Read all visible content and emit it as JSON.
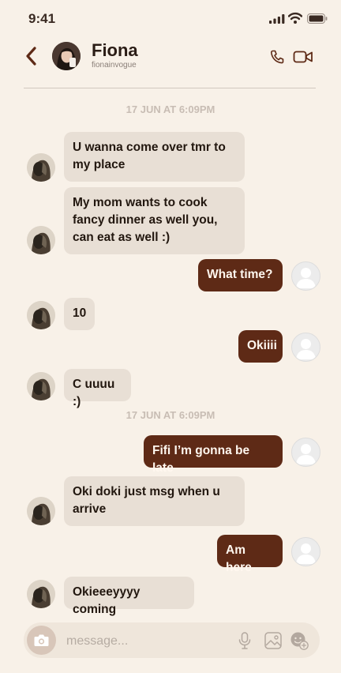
{
  "status_bar": {
    "time": "9:41"
  },
  "header": {
    "name": "Fiona",
    "handle": "fionainvogue"
  },
  "messages": [
    {
      "kind": "timestamp",
      "text": "17 JUN AT 6:09PM"
    },
    {
      "kind": "incoming",
      "text": "U wanna come over tmr to my place"
    },
    {
      "kind": "incoming",
      "text": "My mom wants to cook fancy dinner as well you, can eat as well :)"
    },
    {
      "kind": "outgoing",
      "text": "What time?"
    },
    {
      "kind": "incoming",
      "text": "10"
    },
    {
      "kind": "outgoing",
      "text": "Okiiii"
    },
    {
      "kind": "incoming",
      "text": "C uuuu :)"
    },
    {
      "kind": "timestamp",
      "text": "17 JUN AT 6:09PM"
    },
    {
      "kind": "outgoing",
      "text": "Fifi I’m gonna be late"
    },
    {
      "kind": "incoming",
      "text": "Oki doki just msg when u arrive"
    },
    {
      "kind": "outgoing",
      "text": "Am here"
    },
    {
      "kind": "incoming",
      "text": "Okieeeyyyy coming"
    }
  ],
  "composer": {
    "placeholder": "message..."
  },
  "icons": [
    "back-icon",
    "call-icon",
    "video-icon",
    "camera-icon",
    "mic-icon",
    "gallery-icon",
    "sticker-icon"
  ],
  "colors": {
    "background": "#f8f1e8",
    "incoming_bubble": "#e8dfd5",
    "outgoing_bubble": "#5e2a16",
    "accent": "#5e2a16"
  }
}
